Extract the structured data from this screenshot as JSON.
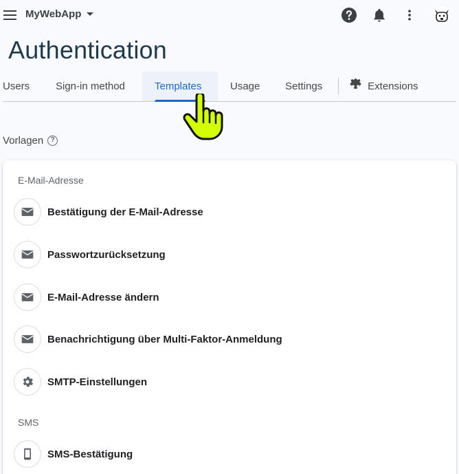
{
  "app": {
    "project_name": "MyWebApp",
    "page_title": "Authentication"
  },
  "header_icons": [
    "menu-icon",
    "help-icon",
    "bell-icon",
    "more-vert-icon",
    "avatar"
  ],
  "tabs": [
    {
      "label": "Users",
      "active": false
    },
    {
      "label": "Sign-in method",
      "active": false
    },
    {
      "label": "Templates",
      "active": true
    },
    {
      "label": "Usage",
      "active": false
    },
    {
      "label": "Settings",
      "active": false
    },
    {
      "label": "Extensions",
      "active": false,
      "icon": "puzzle-icon"
    }
  ],
  "section": {
    "label": "Vorlagen",
    "help_glyph": "?"
  },
  "groups": {
    "email": {
      "title": "E-Mail-Adresse",
      "items": [
        {
          "label": "Bestätigung der E-Mail-Adresse",
          "icon": "mail-icon"
        },
        {
          "label": "Passwortzurücksetzung",
          "icon": "mail-icon"
        },
        {
          "label": "E-Mail-Adresse ändern",
          "icon": "mail-icon"
        },
        {
          "label": "Benachrichtigung über Multi-Faktor-Anmeldung",
          "icon": "mail-icon"
        },
        {
          "label": "SMTP-Einstellungen",
          "icon": "gear-icon"
        }
      ]
    },
    "sms": {
      "title": "SMS",
      "items": [
        {
          "label": "SMS-Bestätigung",
          "icon": "phone-icon"
        }
      ]
    }
  },
  "colors": {
    "accent": "#1a67c8",
    "title": "#1f3a4d",
    "background": "#f8fafd",
    "cursor": "#d4ff00"
  }
}
